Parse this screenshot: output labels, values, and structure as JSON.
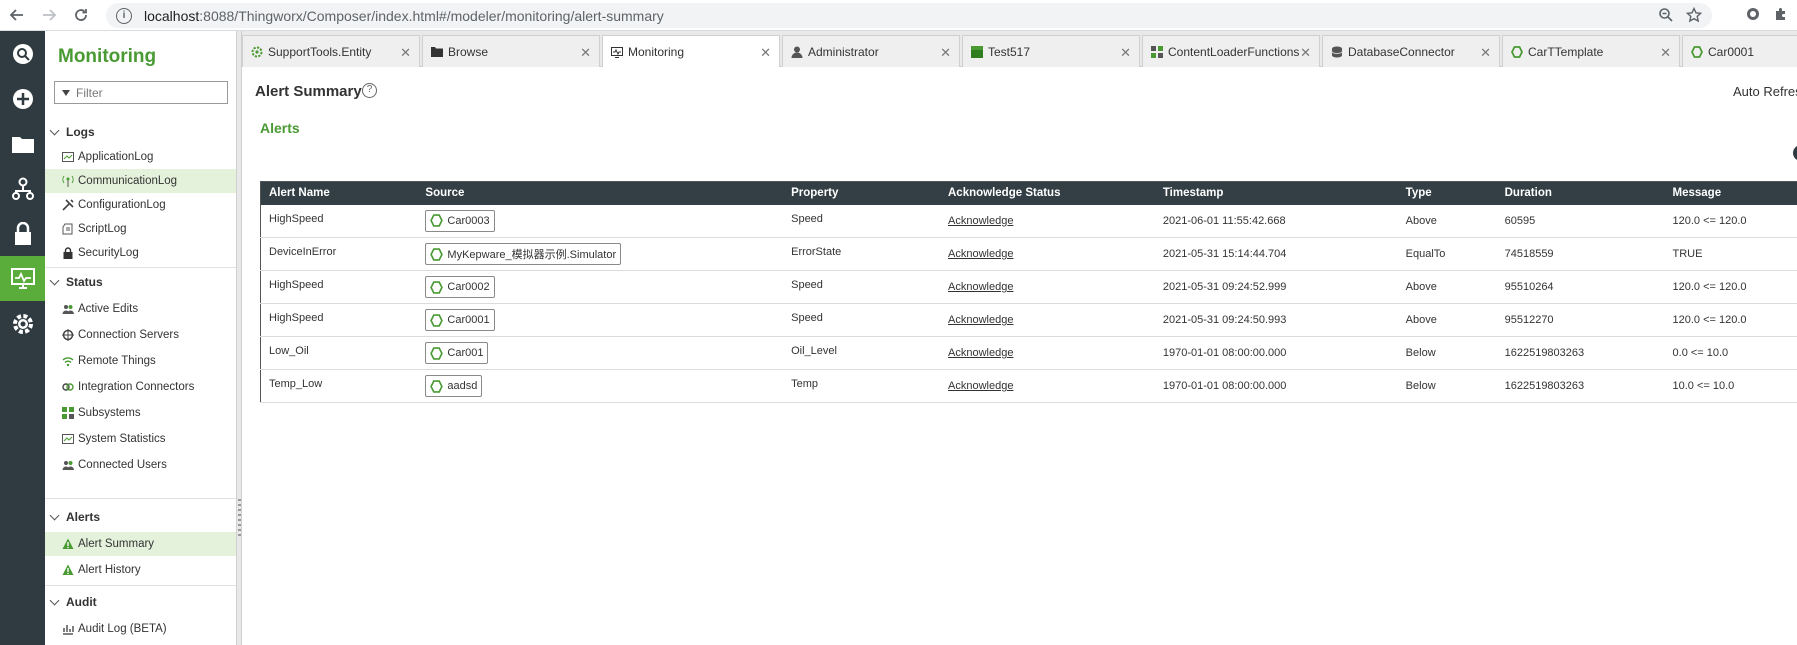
{
  "browser": {
    "url_host": "localhost",
    "url_rest": ":8088/Thingworx/Composer/index.html#/modeler/monitoring/alert-summary"
  },
  "rail": {
    "items": [
      {
        "name": "search-icon"
      },
      {
        "name": "add-icon"
      },
      {
        "name": "folder-icon"
      },
      {
        "name": "hierarchy-icon"
      },
      {
        "name": "lock-icon"
      },
      {
        "name": "monitor-icon",
        "active": true
      },
      {
        "name": "gear-icon"
      }
    ],
    "accent": "#5aad3a"
  },
  "sidebar": {
    "title": "Monitoring",
    "filter_placeholder": "Filter",
    "groups": {
      "logs": {
        "label": "Logs",
        "items": [
          "ApplicationLog",
          "CommunicationLog",
          "ConfigurationLog",
          "ScriptLog",
          "SecurityLog"
        ]
      },
      "status": {
        "label": "Status",
        "items": [
          "Active Edits",
          "Connection Servers",
          "Remote Things",
          "Integration Connectors",
          "Subsystems",
          "System Statistics",
          "Connected Users"
        ]
      },
      "alerts": {
        "label": "Alerts",
        "items": [
          "Alert Summary",
          "Alert History"
        ]
      },
      "audit": {
        "label": "Audit",
        "items": [
          "Audit Log (BETA)"
        ]
      }
    }
  },
  "tabs": [
    {
      "label": "SupportTools.Entity",
      "icon": "gear-icon"
    },
    {
      "label": "Browse",
      "icon": "folder-icon"
    },
    {
      "label": "Monitoring",
      "icon": "monitor-icon",
      "active": true
    },
    {
      "label": "Administrator",
      "icon": "user-icon"
    },
    {
      "label": "Test517",
      "icon": "table-icon"
    },
    {
      "label": "ContentLoaderFunctions",
      "icon": "grid-icon"
    },
    {
      "label": "DatabaseConnector",
      "icon": "database-icon"
    },
    {
      "label": "CarTTemplate",
      "icon": "hexagon-icon"
    },
    {
      "label": "Car0001",
      "icon": "hexagon-icon"
    }
  ],
  "main": {
    "page_title": "Alert Summary",
    "help_glyph": "?",
    "auto_refresh_label": "Auto Refres",
    "section_title": "Alerts",
    "columns": [
      "Alert Name",
      "Source",
      "Property",
      "Acknowledge Status",
      "Timestamp",
      "Type",
      "Duration",
      "Message"
    ],
    "rows": [
      {
        "name": "HighSpeed",
        "source": "Car0003",
        "property": "Speed",
        "ack": "Acknowledge",
        "timestamp": "2021-06-01 11:55:42.668",
        "type": "Above",
        "duration": "60595",
        "message": "120.0 <= 120.0"
      },
      {
        "name": "DeviceInError",
        "source": "MyKepware_模拟器示例.Simulator",
        "property": "ErrorState",
        "ack": "Acknowledge",
        "timestamp": "2021-05-31 15:14:44.704",
        "type": "EqualTo",
        "duration": "74518559",
        "message": "TRUE"
      },
      {
        "name": "HighSpeed",
        "source": "Car0002",
        "property": "Speed",
        "ack": "Acknowledge",
        "timestamp": "2021-05-31 09:24:52.999",
        "type": "Above",
        "duration": "95510264",
        "message": "120.0 <= 120.0"
      },
      {
        "name": "HighSpeed",
        "source": "Car0001",
        "property": "Speed",
        "ack": "Acknowledge",
        "timestamp": "2021-05-31 09:24:50.993",
        "type": "Above",
        "duration": "95512270",
        "message": "120.0 <= 120.0"
      },
      {
        "name": "Low_Oil",
        "source": "Car001",
        "property": "Oil_Level",
        "ack": "Acknowledge",
        "timestamp": "1970-01-01 08:00:00.000",
        "type": "Below",
        "duration": "1622519803263",
        "message": "0.0 <= 10.0"
      },
      {
        "name": "Temp_Low",
        "source": "aadsd",
        "property": "Temp",
        "ack": "Acknowledge",
        "timestamp": "1970-01-01 08:00:00.000",
        "type": "Below",
        "duration": "1622519803263",
        "message": "10.0 <= 10.0"
      }
    ]
  },
  "colors": {
    "brand_green": "#4a9a34",
    "header_dark": "#333f44",
    "rail_dark": "#2f3b40"
  }
}
